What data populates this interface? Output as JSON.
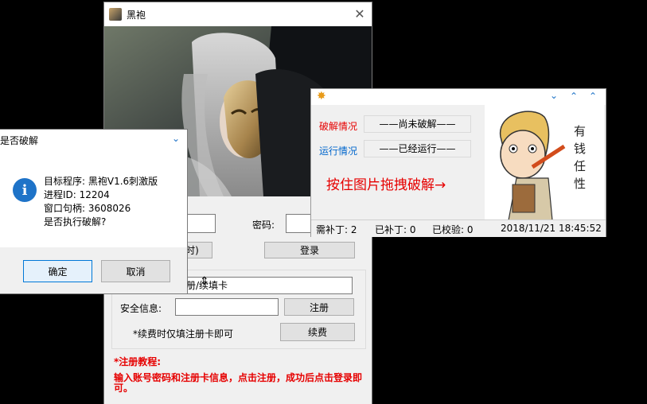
{
  "main_window": {
    "title": "黑袍",
    "password_label": "密码:",
    "login_button": "登录",
    "partial_button": "时)",
    "card_field_value": "注册/续填卡",
    "security_label": "安全信息:",
    "register_button": "注册",
    "renew_note": "*续费时仅填注册卡即可",
    "renew_button": "续费",
    "tutorial_title": "*注册教程:",
    "tutorial_text": "输入账号密码和注册卡信息，点击注册，成功后点击登录即可。"
  },
  "dialog": {
    "title": "是否破解",
    "line1": "目标程序: 黑袍V1.6刺激版",
    "line2": "进程ID: 12204",
    "line3": "窗口句柄: 3608026",
    "line4": "是否执行破解?",
    "ok_button": "确定",
    "cancel_button": "取消"
  },
  "crack_panel": {
    "crack_status_label": "破解情况",
    "crack_status_value": "——尚未破解——",
    "run_status_label": "运行情况",
    "run_status_value": "——已经运行——",
    "drag_hint": "按住图片拖拽破解→",
    "status_bar": {
      "need_patch": "需补丁: 2",
      "patched": "已补丁: 0",
      "verified": "已校验: 0",
      "datetime": "2018/11/21 18:45:52"
    },
    "sticker_text": "有钱任性"
  },
  "colors": {
    "accent_red": "#e60000",
    "label_blue": "#0066cc",
    "info_blue": "#1e73c8"
  }
}
